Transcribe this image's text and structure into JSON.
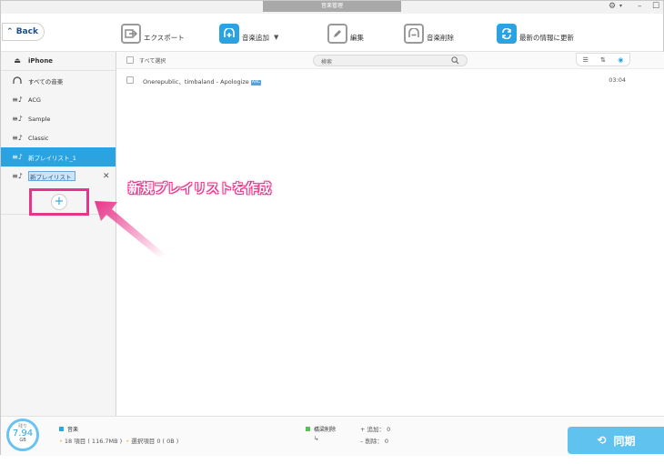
{
  "window": {
    "title": "音楽管理"
  },
  "toolbar": {
    "back_label": "Back",
    "export_label": "エクスポート",
    "add_music_label": "音楽追加",
    "edit_label": "編集",
    "delete_label": "音楽削除",
    "refresh_label": "最新の情報に更新"
  },
  "sidebar": {
    "device": "iPhone",
    "items": [
      {
        "label": "すべての音楽"
      },
      {
        "label": "ACG"
      },
      {
        "label": "Sample"
      },
      {
        "label": "Classic"
      },
      {
        "label": "新プレイリスト_1"
      }
    ],
    "rename_value": "新プレイリスト_2"
  },
  "list": {
    "select_all": "すべて選択",
    "search_placeholder": "検索",
    "rows": [
      {
        "title": "Onerepublic、timbaland - Apologize",
        "badge": "AAC",
        "duration": "03:04"
      }
    ]
  },
  "annotation": {
    "text": "新規プレイリストを作成"
  },
  "footer": {
    "gauge_label": "残り",
    "gauge_value": "7.94",
    "gauge_unit": "GB",
    "category": "音楽",
    "items_text": "18 項目 ( 116.7MB )",
    "selected_text": "選択項目 0 ( 0B )",
    "sync_removal": "橋梁削除",
    "added_text": "追加： 0",
    "deleted_text": "削除： 0",
    "sync_label": "同期"
  },
  "colors": {
    "accent": "#2aa3e0",
    "annotation": "#e8358a",
    "music_square": "#29a8e3",
    "sync_square": "#55c251"
  }
}
